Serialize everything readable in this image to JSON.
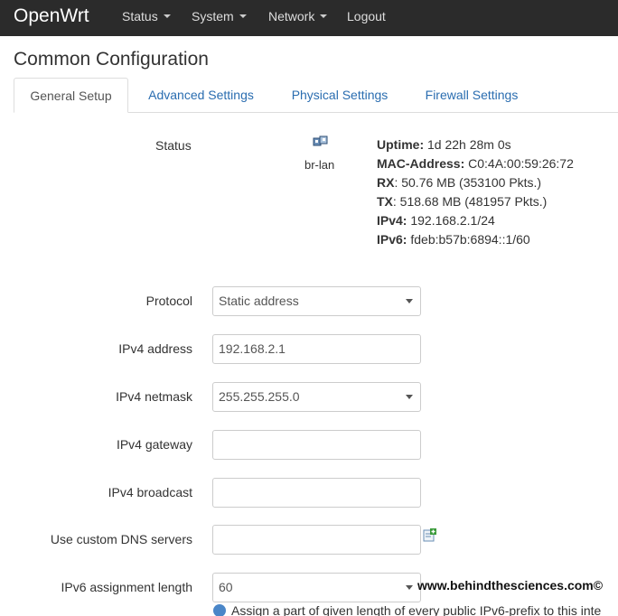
{
  "navbar": {
    "brand": "OpenWrt",
    "items": [
      {
        "label": "Status",
        "dropdown": true
      },
      {
        "label": "System",
        "dropdown": true
      },
      {
        "label": "Network",
        "dropdown": true
      },
      {
        "label": "Logout",
        "dropdown": false
      }
    ]
  },
  "page": {
    "title": "Common Configuration"
  },
  "tabs": [
    {
      "label": "General Setup",
      "active": true
    },
    {
      "label": "Advanced Settings",
      "active": false
    },
    {
      "label": "Physical Settings",
      "active": false
    },
    {
      "label": "Firewall Settings",
      "active": false
    }
  ],
  "status": {
    "label": "Status",
    "interface_icon": "network-interface-icon",
    "interface_name": "br-lan",
    "uptime_label": "Uptime:",
    "uptime": "1d 22h 28m 0s",
    "mac_label": "MAC-Address:",
    "mac": "C0:4A:00:59:26:72",
    "rx_label": "RX",
    "rx": ": 50.76 MB (353100 Pkts.)",
    "tx_label": "TX",
    "tx": ": 518.68 MB (481957 Pkts.)",
    "ipv4_label": "IPv4:",
    "ipv4": "192.168.2.1/24",
    "ipv6_label": "IPv6:",
    "ipv6": "fdeb:b57b:6894::1/60"
  },
  "form": {
    "protocol": {
      "label": "Protocol",
      "value": "Static address"
    },
    "ipv4_address": {
      "label": "IPv4 address",
      "value": "192.168.2.1"
    },
    "ipv4_netmask": {
      "label": "IPv4 netmask",
      "value": "255.255.255.0"
    },
    "ipv4_gateway": {
      "label": "IPv4 gateway",
      "value": ""
    },
    "ipv4_broadcast": {
      "label": "IPv4 broadcast",
      "value": ""
    },
    "custom_dns": {
      "label": "Use custom DNS servers",
      "value": "",
      "add_icon": "add-entry-icon"
    },
    "ipv6_assignment": {
      "label": "IPv6 assignment length",
      "value": "60"
    },
    "help_text": "Assign a part of given length of every public IPv6-prefix to this inte"
  },
  "watermark": "www.behindthesciences.com©",
  "colors": {
    "navbar": "#2b2b2b",
    "link": "#2a6db0",
    "border": "#cccccc"
  }
}
